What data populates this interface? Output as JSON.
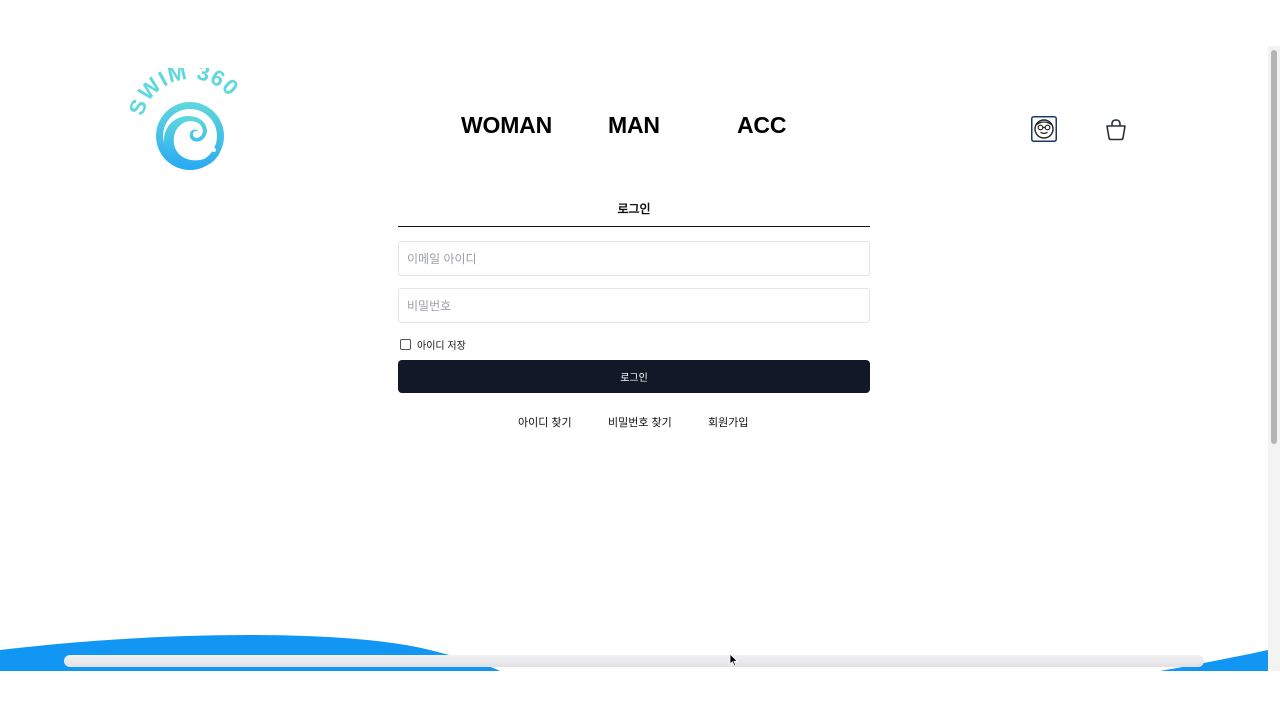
{
  "brand": {
    "logo_text": "SWIM 360",
    "colors": {
      "logo_teal": "#5fd8dc",
      "logo_blue": "#29b6f6",
      "primary_dark": "#111827",
      "wave_blue": "#1296f3"
    }
  },
  "header": {
    "nav": [
      {
        "label": "WOMAN"
      },
      {
        "label": "MAN"
      },
      {
        "label": "ACC"
      }
    ],
    "icons": {
      "user": "swimmer-face-icon",
      "cart": "shopping-bag-icon"
    }
  },
  "login": {
    "tab_label": "로그인",
    "email_placeholder": "이메일 아이디",
    "password_placeholder": "비밀번호",
    "remember_label": "아이디 저장",
    "submit_label": "로그인"
  },
  "links": {
    "find_id": "아이디 찾기",
    "find_password": "비밀번호 찾기",
    "signup": "회원가입"
  }
}
